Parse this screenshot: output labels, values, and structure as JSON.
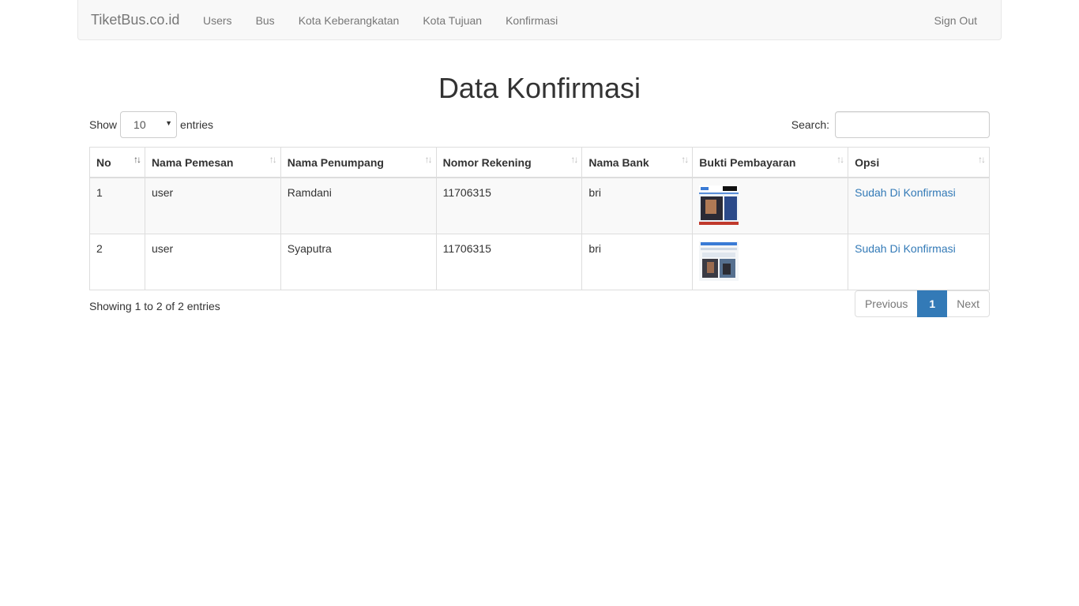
{
  "navbar": {
    "brand": "TiketBus.co.id",
    "links": [
      "Users",
      "Bus",
      "Kota Keberangkatan",
      "Kota Tujuan",
      "Konfirmasi"
    ],
    "signout": "Sign Out"
  },
  "page": {
    "title": "Data Konfirmasi"
  },
  "length": {
    "show_label": "Show",
    "selected": "10",
    "entries_label": "entries"
  },
  "search": {
    "label": "Search:",
    "value": "",
    "placeholder": ""
  },
  "table": {
    "columns": [
      "No",
      "Nama Pemesan",
      "Nama Penumpang",
      "Nomor Rekening",
      "Nama Bank",
      "Bukti Pembayaran",
      "Opsi"
    ],
    "rows": [
      {
        "no": "1",
        "pemesan": "user",
        "penumpang": "Ramdani",
        "rekening": "11706315",
        "bank": "bri",
        "opsi": "Sudah Di Konfirmasi"
      },
      {
        "no": "2",
        "pemesan": "user",
        "penumpang": "Syaputra",
        "rekening": "11706315",
        "bank": "bri",
        "opsi": "Sudah Di Konfirmasi"
      }
    ]
  },
  "footer": {
    "info": "Showing 1 to 2 of 2 entries",
    "previous": "Previous",
    "page": "1",
    "next": "Next"
  },
  "colors": {
    "link": "#337ab7",
    "navbar_bg": "#f8f8f8",
    "active_page": "#337ab7"
  },
  "icons": {
    "sort": "sort-arrows-icon"
  }
}
